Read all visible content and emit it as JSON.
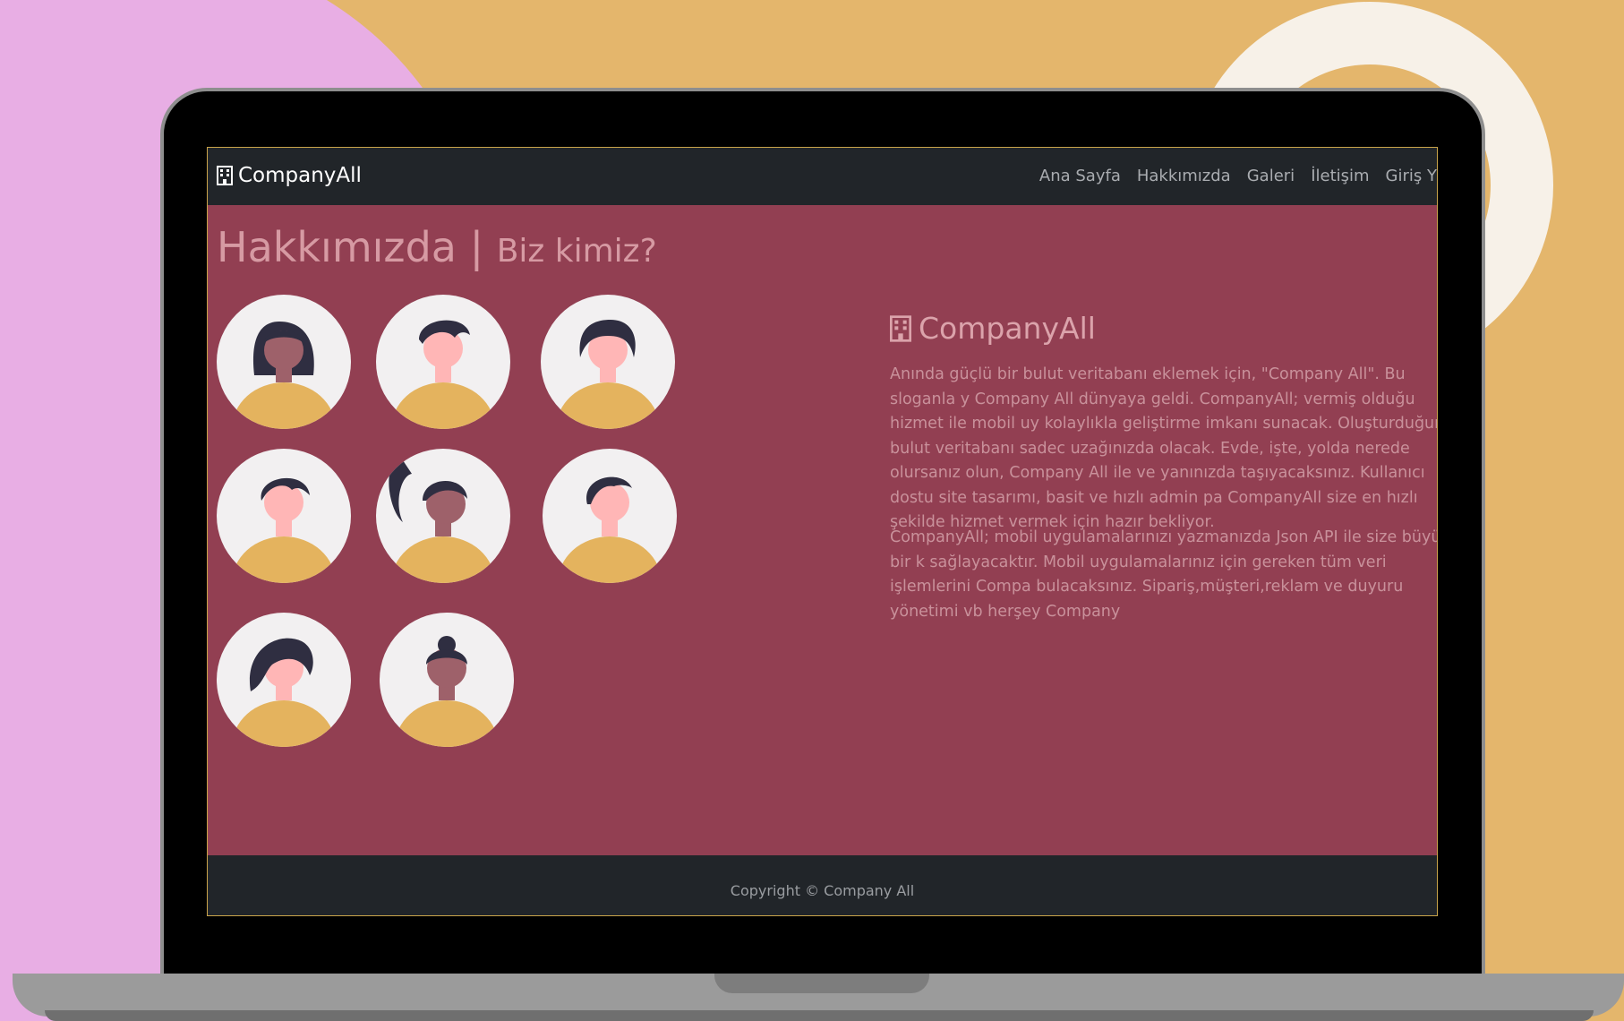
{
  "navbar": {
    "brand": "CompanyAll",
    "links": [
      "Ana Sayfa",
      "Hakkımızda",
      "Galeri",
      "İletişim",
      "Giriş Y"
    ]
  },
  "about": {
    "title": "Hakkımızda |",
    "subtitle": "Biz kimiz?"
  },
  "company": {
    "name": "CompanyAll",
    "paragraph1": "Anında güçlü bir bulut veritabanı eklemek için, \"Company All\". Bu sloganla y Company All dünyaya geldi. CompanyAll; vermiş olduğu hizmet ile mobil uy kolaylıkla geliştirme imkanı sunacak. Oluşturduğunuz bulut veritabanı sadec uzağınızda olacak. Evde, işte, yolda nerede olursanız olun, Company All ile ve yanınızda taşıyacaksınız. Kullanıcı dostu site tasarımı, basit ve hızlı admin pa CompanyAll size en hızlı şekilde hizmet vermek için hazır bekliyor.",
    "paragraph2": "CompanyAll; mobil uygulamalarınızı yazmanızda Json API ile size büyük bir k sağlayacaktır. Mobil uygulamalarınız için gereken tüm veri işlemlerini Compa bulacaksınız. Sipariş,müşteri,reklam ve duyuru yönetimi vb herşey Company"
  },
  "team_icons": [
    "avatar-1",
    "avatar-2",
    "avatar-3",
    "avatar-4",
    "avatar-5",
    "avatar-6",
    "avatar-7",
    "avatar-8"
  ],
  "footer": {
    "copyright": "Copyright © Company All"
  },
  "colors": {
    "background": "#e4b66c",
    "pink": "#e8aee4",
    "page": "#923f52",
    "navbar": "#212529",
    "shirt": "#e4b35e",
    "hair": "#2f2e41"
  }
}
